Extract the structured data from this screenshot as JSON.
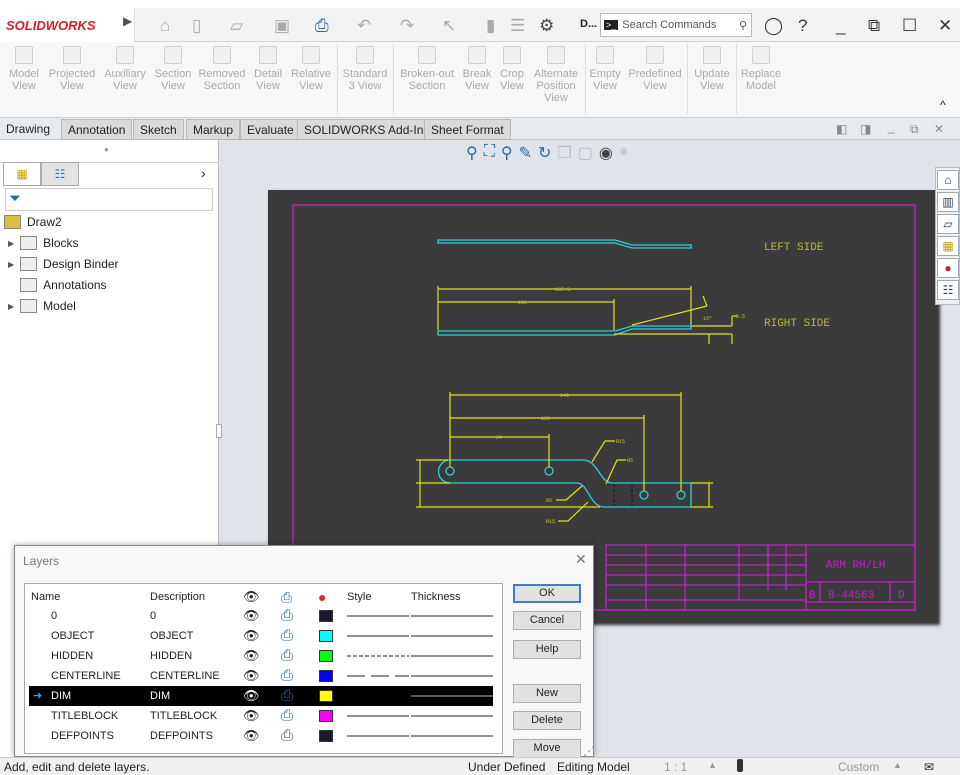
{
  "app": {
    "brand": "SOLIDWORKS",
    "doc_title_truncated": "D...",
    "search_placeholder": "Search Commands"
  },
  "quick_toolbar": [
    "home-icon",
    "new-icon",
    "open-icon",
    "save-icon",
    "print-icon",
    "undo-icon",
    "redo-icon",
    "select-icon",
    "rebuild-icon",
    "file-properties-icon",
    "options-icon"
  ],
  "command_manager": [
    {
      "label": "Model\nView"
    },
    {
      "label": "Projected\nView"
    },
    {
      "label": "Auxiliary\nView"
    },
    {
      "label": "Section\nView"
    },
    {
      "label": "Removed\nSection"
    },
    {
      "label": "Detail\nView"
    },
    {
      "label": "Relative\nView"
    },
    {
      "label": "Standard\n3 View"
    },
    {
      "label": "Broken-out\nSection"
    },
    {
      "label": "Break\nView"
    },
    {
      "label": "Crop\nView"
    },
    {
      "label": "Alternate\nPosition\nView"
    },
    {
      "label": "Empty\nView"
    },
    {
      "label": "Predefined\nView"
    },
    {
      "label": "Update\nView"
    },
    {
      "label": "Replace\nModel"
    }
  ],
  "tabs": [
    "Drawing",
    "Annotation",
    "Sketch",
    "Markup",
    "Evaluate",
    "SOLIDWORKS Add-Ins",
    "Sheet Format"
  ],
  "active_tab": "Drawing",
  "tree": {
    "root": "Draw2",
    "items": [
      {
        "label": "Blocks",
        "expandable": true
      },
      {
        "label": "Design Binder",
        "expandable": true
      },
      {
        "label": "Annotations",
        "expandable": false
      },
      {
        "label": "Model",
        "expandable": true
      }
    ]
  },
  "drawing": {
    "left_label": "LEFT SIDE",
    "right_label": "RIGHT SIDE",
    "dims": {
      "overall": "165.5",
      "to_bend": "135",
      "angle": "15°",
      "offset": "5.5",
      "d149": "149",
      "d125": "125",
      "d64": "64",
      "r15a": "R15",
      "r5a": "R5",
      "r5b": "R5",
      "r15b": "R15"
    },
    "title": "ARM RH/LH",
    "size": "B",
    "dwg_no": "B-44563",
    "rev": "D",
    "colors": {
      "object": "#2fd0d8",
      "dim": "#e0e020",
      "titleblock": "#c020c8",
      "sheet": "#3b3b3b"
    }
  },
  "layers_dialog": {
    "title": "Layers",
    "headers": {
      "name": "Name",
      "description": "Description",
      "style": "Style",
      "thickness": "Thickness"
    },
    "rows": [
      {
        "name": "0",
        "description": "0",
        "color": "#1a1a2a",
        "style": "solid",
        "current": false
      },
      {
        "name": "OBJECT",
        "description": "OBJECT",
        "color": "#00ffff",
        "style": "solid",
        "current": false
      },
      {
        "name": "HIDDEN",
        "description": "HIDDEN",
        "color": "#00ff00",
        "style": "dashed",
        "current": false
      },
      {
        "name": "CENTERLINE",
        "description": "CENTERLINE",
        "color": "#0000ff",
        "style": "center",
        "current": false
      },
      {
        "name": "DIM",
        "description": "DIM",
        "color": "#ffff00",
        "style": "solid",
        "current": true
      },
      {
        "name": "TITLEBLOCK",
        "description": "TITLEBLOCK",
        "color": "#ff00ff",
        "style": "solid",
        "current": false
      },
      {
        "name": "DEFPOINTS",
        "description": "DEFPOINTS",
        "color": "#1a1a2a",
        "style": "solid",
        "current": false
      }
    ],
    "buttons": {
      "ok": "OK",
      "cancel": "Cancel",
      "help": "Help",
      "new": "New",
      "delete": "Delete",
      "move": "Move"
    }
  },
  "status": {
    "message": "Add, edit and delete layers.",
    "state": "Under Defined",
    "mode": "Editing Model",
    "scale": "1 : 1",
    "units": "Custom"
  }
}
